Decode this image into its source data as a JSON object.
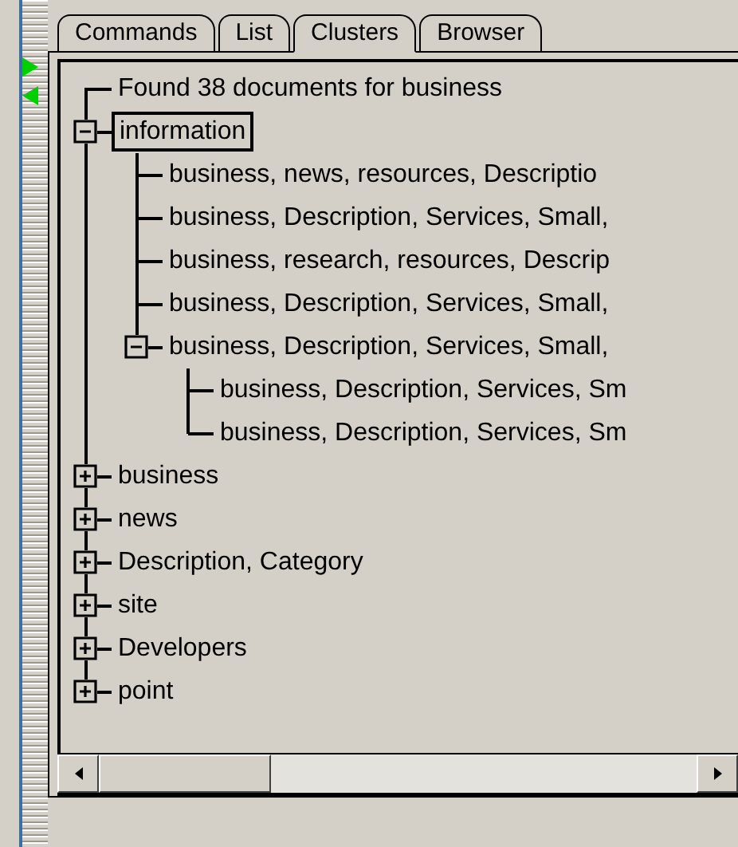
{
  "tabs": [
    {
      "label": "Commands",
      "selected": false
    },
    {
      "label": "List",
      "selected": false
    },
    {
      "label": "Clusters",
      "selected": true
    },
    {
      "label": "Browser",
      "selected": false
    }
  ],
  "tree": [
    {
      "label": "Found 38 documents for business",
      "selected": false
    },
    {
      "label": "information",
      "selected": true,
      "expanded": true,
      "children": [
        {
          "label": "business, news, resources, Descriptio",
          "selected": false
        },
        {
          "label": "business, Description, Services, Small,",
          "selected": false
        },
        {
          "label": "business, research, resources, Descrip",
          "selected": false
        },
        {
          "label": "business, Description, Services, Small,",
          "selected": false
        },
        {
          "label": "business, Description, Services, Small,",
          "selected": false,
          "expanded": true,
          "children": [
            {
              "label": "business, Description, Services, Sm",
              "selected": false
            },
            {
              "label": "business, Description, Services, Sm",
              "selected": false
            }
          ]
        }
      ]
    },
    {
      "label": "business",
      "selected": false,
      "expanded": false
    },
    {
      "label": "news",
      "selected": false,
      "expanded": false
    },
    {
      "label": "Description, Category",
      "selected": false,
      "expanded": false
    },
    {
      "label": "site",
      "selected": false,
      "expanded": false
    },
    {
      "label": "Developers",
      "selected": false,
      "expanded": false
    },
    {
      "label": "point",
      "selected": false,
      "expanded": false
    }
  ]
}
